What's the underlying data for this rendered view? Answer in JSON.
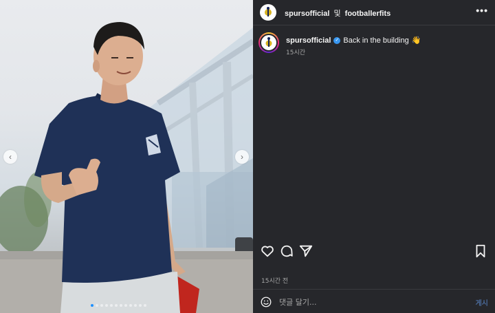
{
  "photo": {
    "prev_icon": "chevron-left-icon",
    "next_icon": "chevron-right-icon",
    "prev_glyph": "‹",
    "next_glyph": "›",
    "dots_count": 12,
    "active_dot": 0
  },
  "header": {
    "user1": "spursofficial",
    "joiner": "및",
    "user2": "footballerfits",
    "more_glyph": "•••"
  },
  "caption": {
    "username": "spursofficial",
    "verified_glyph": "✓",
    "text": "Back in the building",
    "emoji": "👋",
    "time": "15시간"
  },
  "actions": {
    "like_icon": "heart-icon",
    "comment_icon": "comment-icon",
    "share_icon": "send-icon",
    "save_icon": "bookmark-icon"
  },
  "post": {
    "time": "15시간 전"
  },
  "comment_bar": {
    "emoji_icon": "smiley-icon",
    "placeholder": "댓글 달기...",
    "post_label": "게시"
  },
  "colors": {
    "panel_bg": "#26272b",
    "verified": "#3897f0",
    "post_button": "#4a6a9a",
    "secondary_text": "#a8a8a8"
  }
}
